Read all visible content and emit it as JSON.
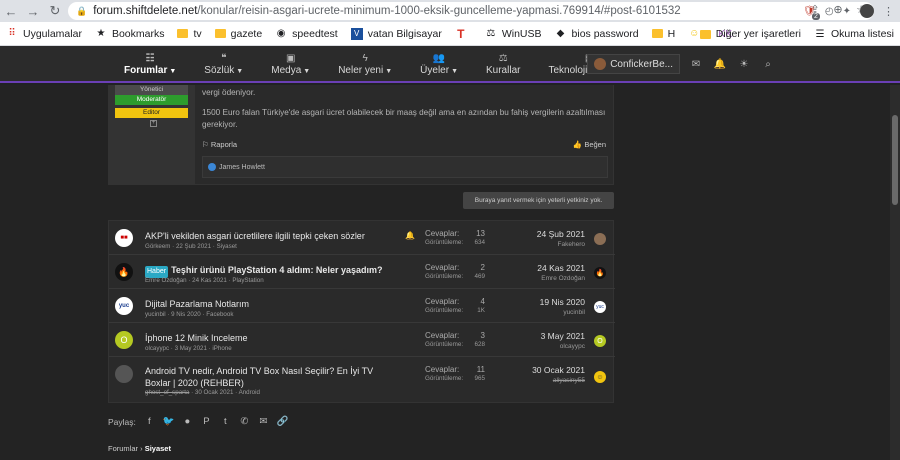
{
  "browser": {
    "url_domain": "forum.shiftdelete.net",
    "url_path": "/konular/reisin-asgari-ucrete-minimum-1000-eksik-guncelleme-yapmasi.769914/#post-6101532",
    "extension_badge": "2",
    "bookmarks": [
      {
        "label": "Uygulamalar",
        "icon": "apps-icon"
      },
      {
        "label": "Bookmarks",
        "icon": "star-icon"
      },
      {
        "label": "tv",
        "icon": "folder-icon"
      },
      {
        "label": "gazete",
        "icon": "folder-icon"
      },
      {
        "label": "speedtest",
        "icon": "speedtest-icon"
      },
      {
        "label": "vatan Bilgisayar",
        "icon": "vatan-icon"
      },
      {
        "label": "",
        "icon": "t-icon"
      },
      {
        "label": "WinUSB",
        "icon": "winusb-icon"
      },
      {
        "label": "bios password",
        "icon": "bios-icon"
      },
      {
        "label": "H",
        "icon": "folder-icon"
      },
      {
        "label": "",
        "icon": "emoji-icon"
      },
      {
        "label": "KK",
        "icon": "kk-icon"
      }
    ],
    "bookmarks_right": [
      "Diğer yer işaretleri",
      "Okuma listesi"
    ]
  },
  "forum_nav": {
    "items": [
      {
        "label": "Forumlar"
      },
      {
        "label": "Sözlük"
      },
      {
        "label": "Medya"
      },
      {
        "label": "Neler yeni"
      },
      {
        "label": "Üyeler"
      },
      {
        "label": "Kurallar"
      },
      {
        "label": "Teknoloji Haberleri"
      }
    ],
    "username": "ConfickerBe..."
  },
  "post": {
    "roles": [
      "Yönetici",
      "Moderatör",
      "Editor"
    ],
    "expand": "+",
    "text_top": "vergi ödeniyor.",
    "text_body": "1500 Euro falan Türkiye'de asgari ücret olabilecek bir maaş değil ama en azından bu fahiş vergilerin azaltılması gerekiyor.",
    "report_label": "Raporla",
    "like_label": "Beğen",
    "reaction_user": "James Howlett"
  },
  "reply_notice": "Buraya yanıt vermek için yeterli yetkiniz yok.",
  "threads": [
    {
      "title": "AKP'li vekilden asgari ücretlilere ilgili tepki çeken sözler",
      "prefix": "",
      "author": "Görkeem",
      "date": "22 Şub 2021",
      "forum": "Siyaset",
      "replies": "13",
      "views": "634",
      "last_date": "24 Şub 2021",
      "last_user": "Fakehero",
      "av": "flag"
    },
    {
      "title": "Teşhir ürünü PlayStation 4 aldım: Neler yaşadım?",
      "prefix": "Haber",
      "author": "Emre Ozdoğan",
      "date": "24 Kas 2021",
      "forum": "PlayStation",
      "replies": "2",
      "views": "469",
      "last_date": "24 Kas 2021",
      "last_user": "Emre Ozdoğan",
      "av": "fire"
    },
    {
      "title": "Dijital Pazarlama Notlarım",
      "prefix": "",
      "author": "yucinbil",
      "date": "9 Nis 2020",
      "forum": "Facebook",
      "replies": "4",
      "views": "1K",
      "last_date": "19 Nis 2020",
      "last_user": "yucinbil",
      "av": "yuc"
    },
    {
      "title": "İphone 12 Minik Inceleme",
      "prefix": "",
      "author": "olcayypc",
      "date": "3 May 2021",
      "forum": "iPhone",
      "replies": "3",
      "views": "628",
      "last_date": "3 May 2021",
      "last_user": "olcayypc",
      "av": "O"
    },
    {
      "title": "Android TV nedir, Android TV Box Nasıl Seçilir? En İyi TV Boxlar | 2020 (REHBER)",
      "prefix": "",
      "author": "ghost_of_sparta",
      "date": "30 Ocak 2021",
      "forum": "Android",
      "replies": "11",
      "views": "965",
      "last_date": "30 Ocak 2021",
      "last_user": "aliyasiny55",
      "av": "photo"
    }
  ],
  "labels": {
    "replies": "Cevaplar:",
    "views": "Görüntüleme:"
  },
  "share_label": "Paylaş:",
  "breadcrumb": {
    "root": "Forumlar",
    "current": "Siyaset"
  },
  "colors": {
    "accent": "#6a3fb5",
    "moderator": "#2d9c2d",
    "editor": "#f1c40f",
    "prefix": "#2aa8c4"
  }
}
